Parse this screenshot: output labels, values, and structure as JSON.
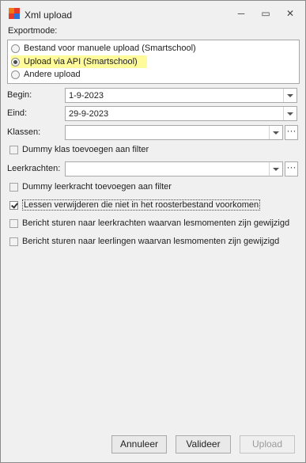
{
  "window": {
    "title": "Xml upload"
  },
  "titlebar": {
    "minimize": "─",
    "restore": "▭",
    "close": "✕"
  },
  "exportmode": {
    "label": "Exportmode:",
    "options": [
      {
        "label": "Bestand voor manuele upload (Smartschool)",
        "selected": false
      },
      {
        "label": "Upload via API (Smartschool)",
        "selected": true
      },
      {
        "label": "Andere upload",
        "selected": false
      }
    ]
  },
  "fields": {
    "begin": {
      "label": "Begin:",
      "value": "1-9-2023"
    },
    "eind": {
      "label": "Eind:",
      "value": "29-9-2023"
    },
    "klassen": {
      "label": "Klassen:",
      "value": "",
      "ellipsis": "···"
    },
    "leerkrachten": {
      "label": "Leerkrachten:",
      "value": "",
      "ellipsis": "···"
    }
  },
  "checkboxes": {
    "dummy_klas": {
      "label": "Dummy klas toevoegen aan filter",
      "checked": false
    },
    "dummy_leerkracht": {
      "label": "Dummy leerkracht toevoegen aan filter",
      "checked": false
    },
    "lessen_verwijderen": {
      "label": "Lessen verwijderen die niet in het roosterbestand voorkomen",
      "checked": true
    },
    "bericht_leerkrachten": {
      "label": "Bericht sturen naar leerkrachten waarvan lesmomenten zijn gewijzigd",
      "checked": false
    },
    "bericht_leerlingen": {
      "label": "Bericht sturen naar leerlingen waarvan lesmomenten zijn gewijzigd",
      "checked": false
    }
  },
  "buttons": {
    "annuleer": "Annuleer",
    "valideer": "Valideer",
    "upload": "Upload"
  },
  "colors": {
    "highlight": "#fffb9a",
    "icon_orange": "#f07a12",
    "icon_red": "#e6392b",
    "icon_blue": "#2f6fd6"
  }
}
